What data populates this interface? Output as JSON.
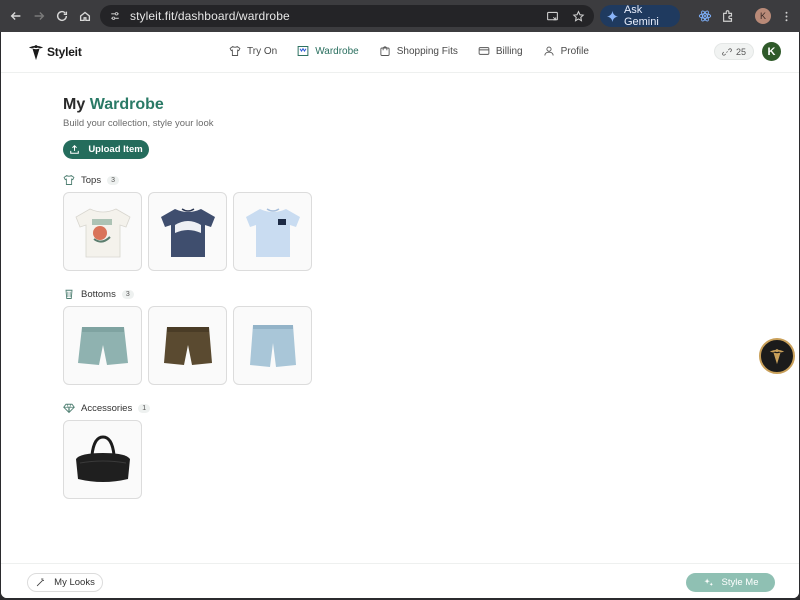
{
  "browser": {
    "url": "styleit.fit/dashboard/wardrobe",
    "gemini_label": "Ask Gemini",
    "profile_initial": "K"
  },
  "app": {
    "brand": "Styleit",
    "nav": [
      {
        "label": "Try On",
        "icon": "shirt-icon",
        "active": false
      },
      {
        "label": "Wardrobe",
        "icon": "wardrobe-icon",
        "active": true
      },
      {
        "label": "Shopping Fits",
        "icon": "shopping-bag-icon",
        "active": false
      },
      {
        "label": "Billing",
        "icon": "credit-card-icon",
        "active": false
      },
      {
        "label": "Profile",
        "icon": "user-icon",
        "active": false
      }
    ],
    "credits": "25",
    "avatar_initial": "K"
  },
  "page": {
    "title_prefix": "My",
    "title_accent": "Wardrobe",
    "subtitle": "Build your collection, style your look",
    "upload_label": "Upload Item"
  },
  "sections": [
    {
      "label": "Tops",
      "count": "3",
      "icon": "shirt-icon",
      "items": [
        "white graphic tee",
        "navy San Diego tee",
        "light blue tee"
      ]
    },
    {
      "label": "Bottoms",
      "count": "3",
      "icon": "bin-icon",
      "items": [
        "sage linen shorts",
        "olive shorts",
        "light denim shorts"
      ]
    },
    {
      "label": "Accessories",
      "count": "1",
      "icon": "gem-icon",
      "items": [
        "black leather duffle bag"
      ]
    }
  ],
  "footer": {
    "my_looks": "My Looks",
    "style_me": "Style Me"
  },
  "colors": {
    "accent": "#2a7a66",
    "button": "#246c5c",
    "style_me": "#8fc0b3"
  }
}
